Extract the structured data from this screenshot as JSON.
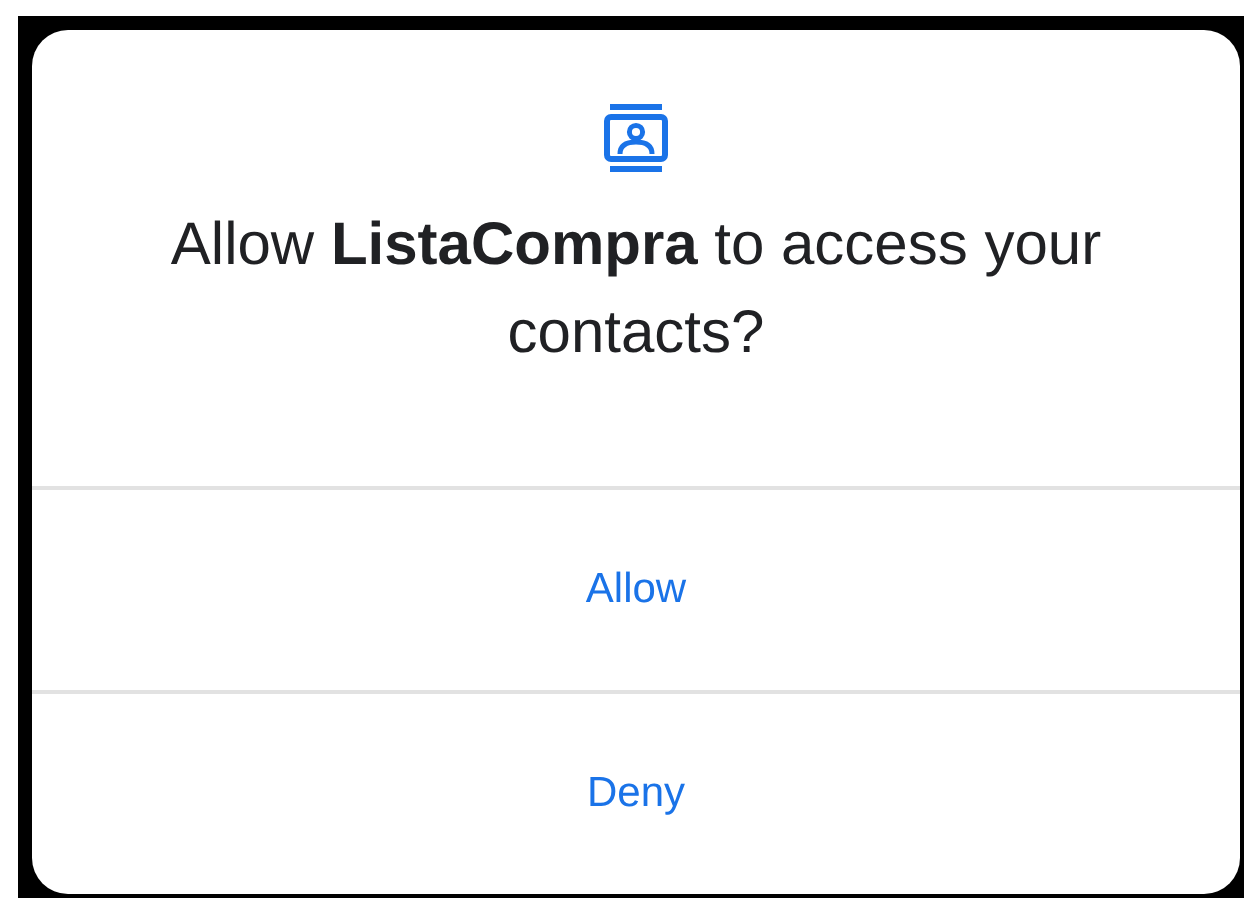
{
  "dialog": {
    "title": "Allow **ListaCompra** to access your contacts?",
    "buttons": [
      {
        "label": "Allow"
      },
      {
        "label": "Deny"
      }
    ]
  }
}
